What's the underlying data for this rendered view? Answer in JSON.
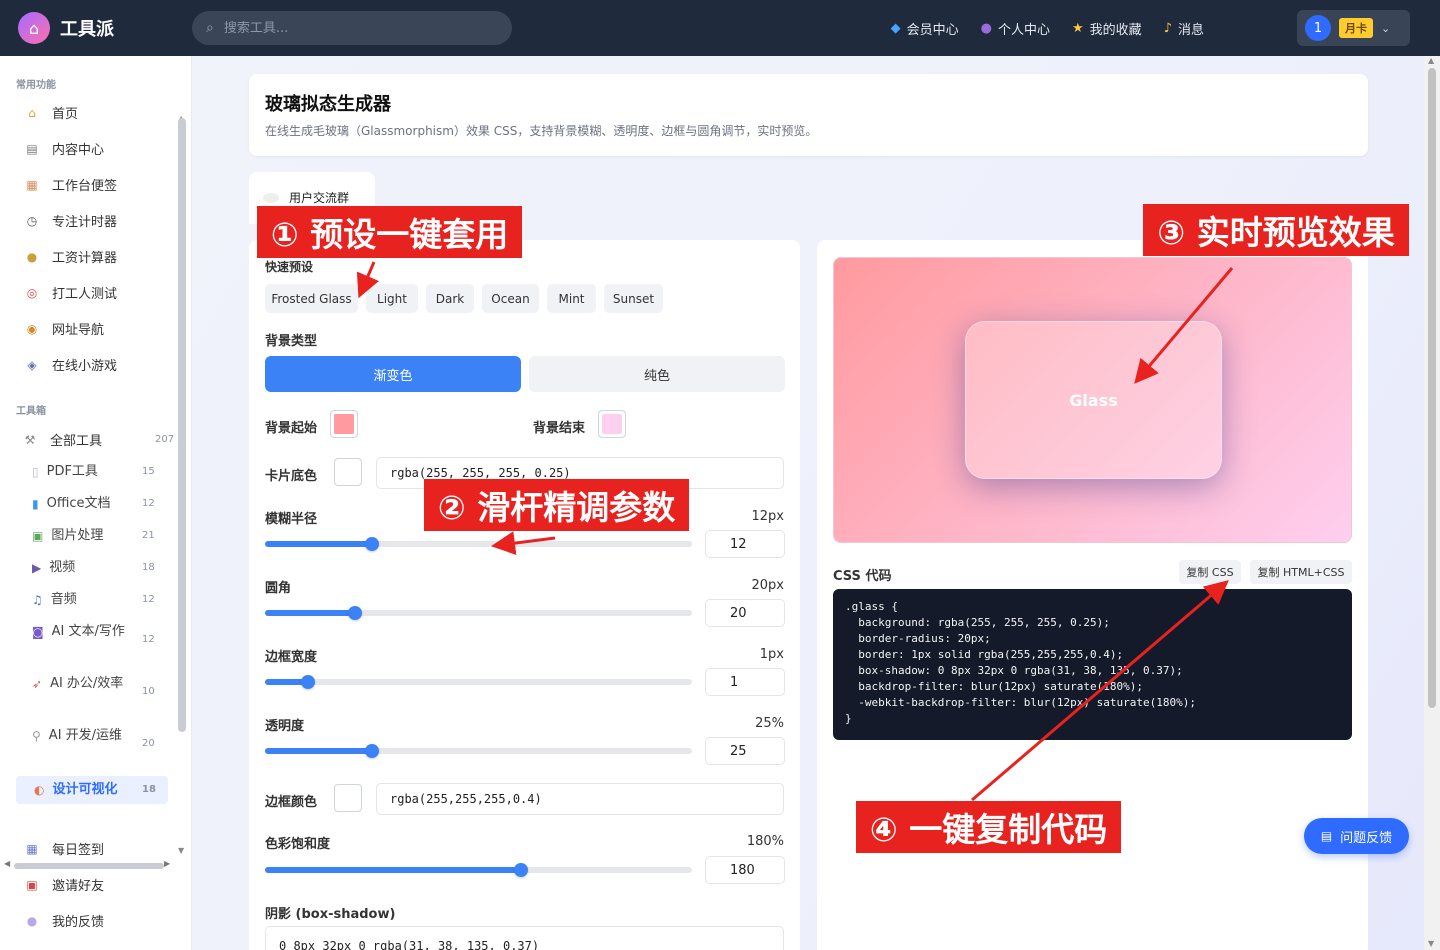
{
  "app": {
    "name": "工具派",
    "logo_icon": "toolbox-icon"
  },
  "search": {
    "placeholder": "搜索工具..."
  },
  "topnav": [
    {
      "label": "会员中心",
      "icon": "diamond-icon"
    },
    {
      "label": "个人中心",
      "icon": "user-icon"
    },
    {
      "label": "我的收藏",
      "icon": "star-icon"
    },
    {
      "label": "消息",
      "icon": "bell-icon"
    }
  ],
  "user": {
    "avatar": "1",
    "badge": "月卡"
  },
  "sidebar": {
    "section1": "常用功能",
    "items": [
      {
        "label": "首页",
        "icon": "home-icon"
      },
      {
        "label": "内容中心",
        "icon": "newspaper-icon"
      },
      {
        "label": "工作台便签",
        "icon": "note-icon"
      },
      {
        "label": "专注计时器",
        "icon": "timer-icon"
      },
      {
        "label": "工资计算器",
        "icon": "money-bag-icon"
      },
      {
        "label": "打工人测试",
        "icon": "target-icon"
      },
      {
        "label": "网址导航",
        "icon": "compass-icon"
      },
      {
        "label": "在线小游戏",
        "icon": "gamepad-icon"
      }
    ],
    "section2": "工具箱",
    "all_tools": {
      "label": "全部工具",
      "count": "207"
    },
    "sub": [
      {
        "label": "PDF工具",
        "count": "15",
        "icon": "pdf-icon"
      },
      {
        "label": "Office文档",
        "count": "12",
        "icon": "doc-icon"
      },
      {
        "label": "图片处理",
        "count": "21",
        "icon": "image-icon"
      },
      {
        "label": "视频",
        "count": "18",
        "icon": "video-icon"
      },
      {
        "label": "音频",
        "count": "12",
        "icon": "music-icon"
      },
      {
        "label": "AI 文本/写作",
        "count": "12",
        "icon": "robot-icon"
      },
      {
        "label": "AI 办公/效率",
        "count": "10",
        "icon": "rocket-icon"
      },
      {
        "label": "AI 开发/运维",
        "count": "20",
        "icon": "wrench-icon"
      },
      {
        "label": "设计可视化",
        "count": "18",
        "icon": "palette-icon"
      }
    ],
    "bottom": [
      {
        "label": "每日签到",
        "icon": "calendar-icon"
      },
      {
        "label": "邀请好友",
        "icon": "gift-icon"
      },
      {
        "label": "我的反馈",
        "icon": "chat-icon"
      }
    ]
  },
  "page": {
    "title": "玻璃拟态生成器",
    "subtitle": "在线生成毛玻璃（Glassmorphism）效果 CSS，支持背景模糊、透明度、边框与圆角调节，实时预览。",
    "group_tab": "用户交流群"
  },
  "controls": {
    "presets_label": "快速预设",
    "presets": [
      "Frosted Glass",
      "Light",
      "Dark",
      "Ocean",
      "Mint",
      "Sunset"
    ],
    "bg_type_label": "背景类型",
    "bg_types": [
      "渐变色",
      "纯色"
    ],
    "bg_start_label": "背景起始",
    "bg_end_label": "背景结束",
    "bg_start_color": "#ff9a9e",
    "bg_end_color": "#fecfef",
    "card_color_label": "卡片底色",
    "card_color_value": "rgba(255, 255, 255, 0.25)",
    "blur": {
      "label": "模糊半径",
      "display": "12px",
      "value": "12",
      "fraction": 0.25
    },
    "radius": {
      "label": "圆角",
      "display": "20px",
      "value": "20",
      "fraction": 0.21
    },
    "border_width": {
      "label": "边框宽度",
      "display": "1px",
      "value": "1",
      "fraction": 0.1
    },
    "opacity": {
      "label": "透明度",
      "display": "25%",
      "value": "25",
      "fraction": 0.25
    },
    "border_color_label": "边框颜色",
    "border_color_value": "rgba(255,255,255,0.4)",
    "saturate": {
      "label": "色彩饱和度",
      "display": "180%",
      "value": "180",
      "fraction": 0.6
    },
    "shadow_label": "阴影 (box-shadow)",
    "shadow_value": "0 8px 32px 0 rgba(31, 38, 135, 0.37)"
  },
  "preview": {
    "glass_text": "Glass"
  },
  "css_panel": {
    "title": "CSS 代码",
    "copy_css": "复制 CSS",
    "copy_html": "复制 HTML+CSS",
    "code": ".glass {\n  background: rgba(255, 255, 255, 0.25);\n  border-radius: 20px;\n  border: 1px solid rgba(255,255,255,0.4);\n  box-shadow: 0 8px 32px 0 rgba(31, 38, 135, 0.37);\n  backdrop-filter: blur(12px) saturate(180%);\n  -webkit-backdrop-filter: blur(12px) saturate(180%);\n}"
  },
  "feedback_button": "问题反馈",
  "annotations": {
    "a1": "① 预设一键套用",
    "a2": "② 滑杆精调参数",
    "a3": "③ 实时预览效果",
    "a4": "④ 一键复制代码"
  }
}
